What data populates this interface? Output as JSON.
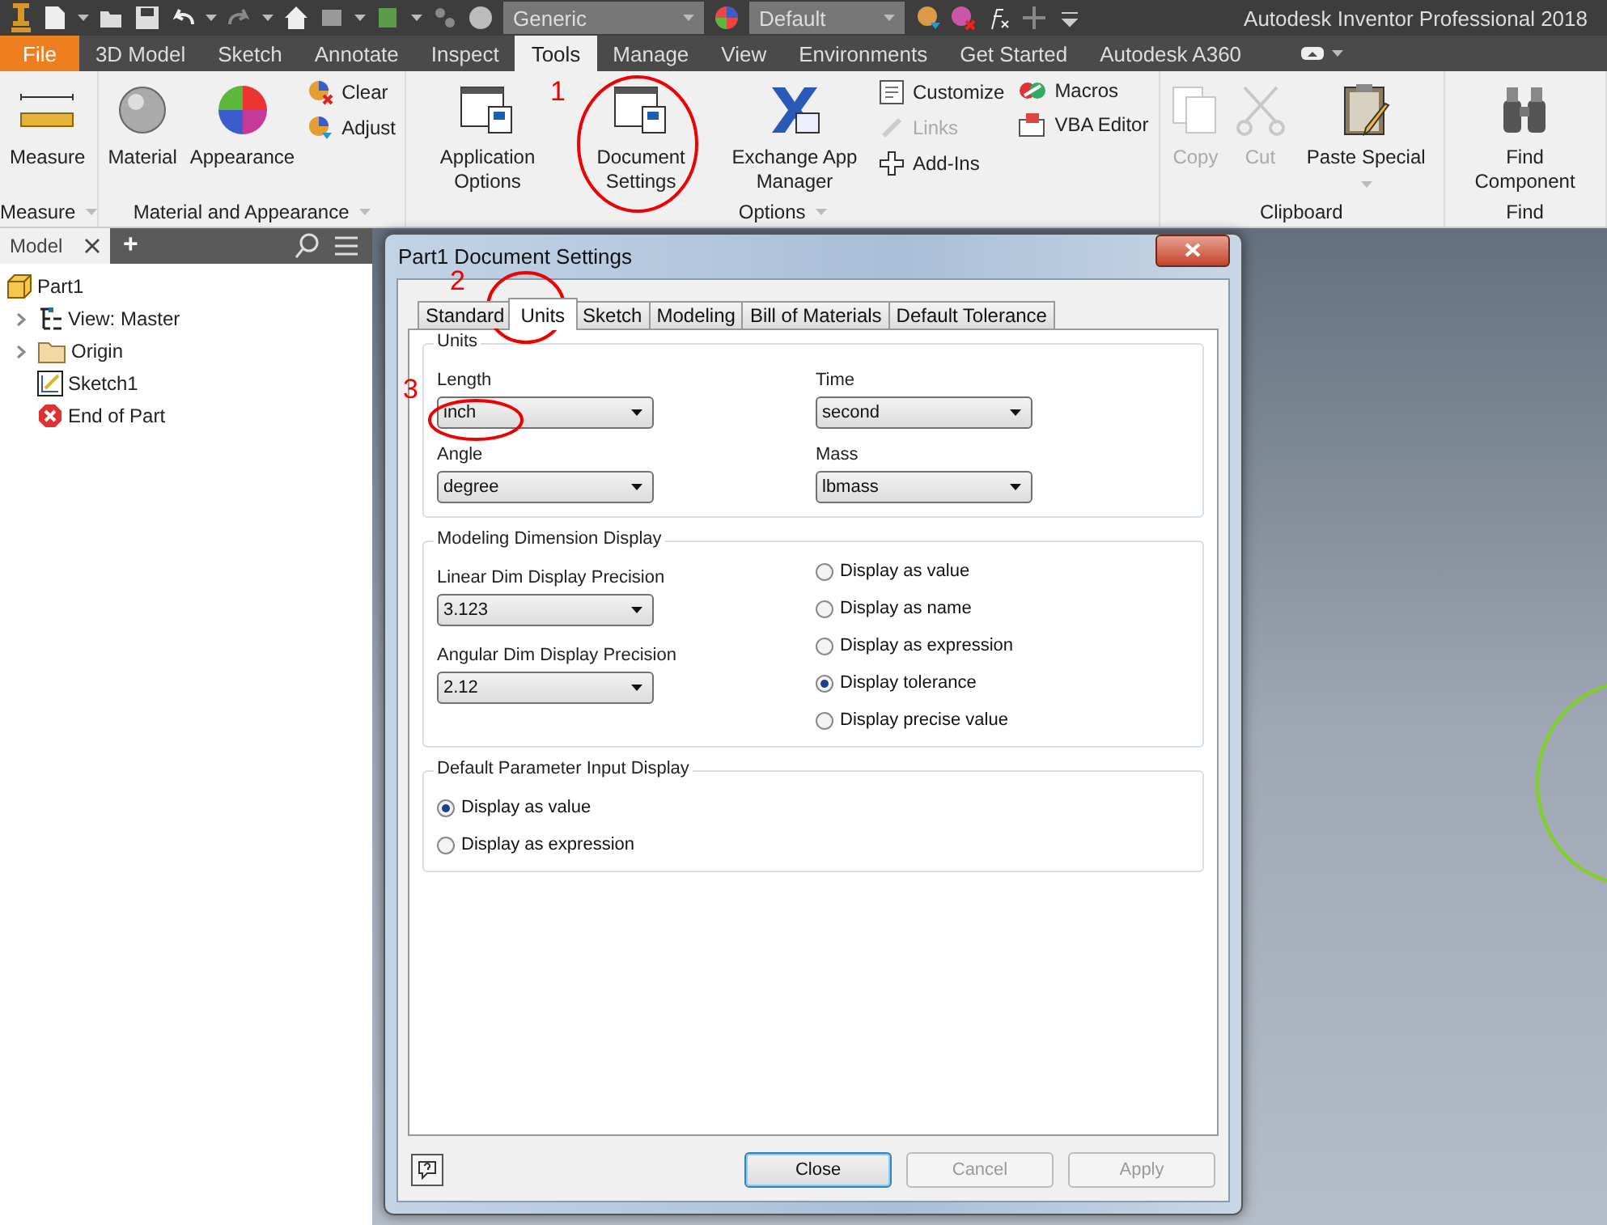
{
  "title_bar": {
    "material_combo": "Generic",
    "appearance_combo": "Default",
    "app_title": "Autodesk Inventor Professional 2018"
  },
  "ribbon_tabs": [
    {
      "label": "File",
      "kind": "app",
      "selected": false
    },
    {
      "label": "3D Model",
      "kind": "tab",
      "selected": false
    },
    {
      "label": "Sketch",
      "kind": "tab",
      "selected": false
    },
    {
      "label": "Annotate",
      "kind": "tab",
      "selected": false
    },
    {
      "label": "Inspect",
      "kind": "tab",
      "selected": false
    },
    {
      "label": "Tools",
      "kind": "tab",
      "selected": true
    },
    {
      "label": "Manage",
      "kind": "tab",
      "selected": false
    },
    {
      "label": "View",
      "kind": "tab",
      "selected": false
    },
    {
      "label": "Environments",
      "kind": "tab",
      "selected": false
    },
    {
      "label": "Get Started",
      "kind": "tab",
      "selected": false
    },
    {
      "label": "Autodesk A360",
      "kind": "tab",
      "selected": false
    }
  ],
  "ribbon_panels": [
    {
      "title": "Measure",
      "tools": [
        {
          "label": "Measure",
          "kind": "large",
          "disabled": false
        }
      ]
    },
    {
      "title": "Material and Appearance",
      "tools": [
        {
          "label": "Material",
          "kind": "large",
          "disabled": false
        },
        {
          "label": "Appearance",
          "kind": "large",
          "disabled": false
        },
        {
          "label": "Clear",
          "kind": "small",
          "disabled": false
        },
        {
          "label": "Adjust",
          "kind": "small",
          "disabled": false
        }
      ]
    },
    {
      "title": "Options",
      "tools": [
        {
          "label": "Application Options",
          "kind": "large",
          "disabled": false
        },
        {
          "label": "Document Settings",
          "kind": "large",
          "disabled": false
        },
        {
          "label": "Exchange App Manager",
          "kind": "large",
          "disabled": false
        },
        {
          "label": "Customize",
          "kind": "small",
          "disabled": false
        },
        {
          "label": "Links",
          "kind": "small",
          "disabled": true
        },
        {
          "label": "Add-Ins",
          "kind": "small",
          "disabled": false
        },
        {
          "label": "Macros",
          "kind": "small",
          "disabled": false
        },
        {
          "label": "VBA Editor",
          "kind": "small",
          "disabled": false
        }
      ]
    },
    {
      "title": "Clipboard",
      "tools": [
        {
          "label": "Copy",
          "kind": "large",
          "disabled": true
        },
        {
          "label": "Cut",
          "kind": "large",
          "disabled": true
        },
        {
          "label": "Paste Special",
          "kind": "large",
          "disabled": false
        }
      ]
    },
    {
      "title": "Find",
      "tools": [
        {
          "label": "Find Component",
          "kind": "large",
          "disabled": false
        }
      ]
    }
  ],
  "browser": {
    "tab": "Model",
    "add": "+",
    "tree": [
      {
        "label": "Part1",
        "children": [
          {
            "label": "View: Master",
            "expandable": true
          },
          {
            "label": "Origin",
            "expandable": true
          },
          {
            "label": "Sketch1",
            "expandable": false
          },
          {
            "label": "End of Part",
            "expandable": false
          }
        ]
      }
    ]
  },
  "dialog": {
    "title": "Part1 Document Settings",
    "tabs": [
      {
        "label": "Standard",
        "selected": false
      },
      {
        "label": "Units",
        "selected": true
      },
      {
        "label": "Sketch",
        "selected": false
      },
      {
        "label": "Modeling",
        "selected": false
      },
      {
        "label": "Bill of Materials",
        "selected": false
      },
      {
        "label": "Default Tolerance",
        "selected": false
      }
    ],
    "units": {
      "title": "Units",
      "fields": [
        {
          "label": "Length",
          "value": "inch"
        },
        {
          "label": "Time",
          "value": "second"
        },
        {
          "label": "Angle",
          "value": "degree"
        },
        {
          "label": "Mass",
          "value": "lbmass"
        }
      ]
    },
    "modeling_dimension_display": {
      "title": "Modeling Dimension Display",
      "fields": [
        {
          "label": "Linear Dim Display Precision",
          "value": "3.123"
        },
        {
          "label": "Angular Dim Display Precision",
          "value": "2.12"
        }
      ],
      "options": [
        {
          "label": "Display as value",
          "selected": false
        },
        {
          "label": "Display as name",
          "selected": false
        },
        {
          "label": "Display as expression",
          "selected": false
        },
        {
          "label": "Display tolerance",
          "selected": true
        },
        {
          "label": "Display precise value",
          "selected": false
        }
      ]
    },
    "default_parameter_input_display": {
      "title": "Default Parameter Input Display",
      "options": [
        {
          "label": "Display as value",
          "selected": true
        },
        {
          "label": "Display as expression",
          "selected": false
        }
      ]
    },
    "buttons": [
      {
        "label": "Close",
        "disabled": false
      },
      {
        "label": "Cancel",
        "disabled": true
      },
      {
        "label": "Apply",
        "disabled": true
      }
    ]
  },
  "annotations": [
    {
      "label": "1"
    },
    {
      "label": "2"
    },
    {
      "label": "3"
    }
  ]
}
